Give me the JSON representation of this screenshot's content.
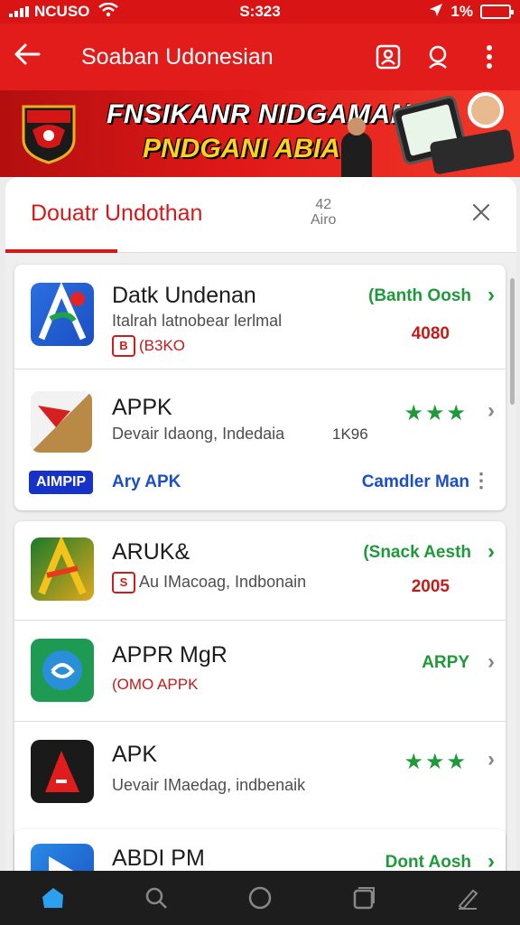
{
  "status": {
    "carrier": "NCUSO",
    "time": "S:323",
    "battery": "1%"
  },
  "appbar": {
    "title": "Soaban Udonesian"
  },
  "banner": {
    "line1": "FNSIKANR NIDGAMAN",
    "line2": "PNDGANI ABIA"
  },
  "sheet": {
    "tab_label": "Douatr Undothan",
    "mid_label_top": "42",
    "mid_label_bottom": "Airo"
  },
  "apps": [
    {
      "name": "Datk Undenan",
      "sub": "Italrah latnobear lerlmal",
      "badge": "B",
      "code": "(B3KO",
      "action": "(Banth Oosh",
      "number": "4080"
    },
    {
      "name": "APPK",
      "sub": "Devair Idaong, Indedaia",
      "side_number": "1K96",
      "pill": "AIMPIP",
      "pill_label": "Ary APK",
      "right_link": "Camdler Man"
    },
    {
      "name": "ARUK&",
      "sub": "Au IMacoag, Indbonain",
      "badge": "S",
      "action": "(Snack Aesth",
      "number": "2005"
    },
    {
      "name": "APPR MgR",
      "code": "(OMO APPK",
      "action": "ARPY"
    },
    {
      "name": "APK",
      "sub": "Uevair IMaedag, indbenaik"
    },
    {
      "name": "ABDI PM",
      "action": "Dont Aosh"
    }
  ],
  "colors": {
    "brand_red": "#e21b1b",
    "accent_green": "#1f9a3a",
    "link_blue": "#1c4fc6"
  }
}
